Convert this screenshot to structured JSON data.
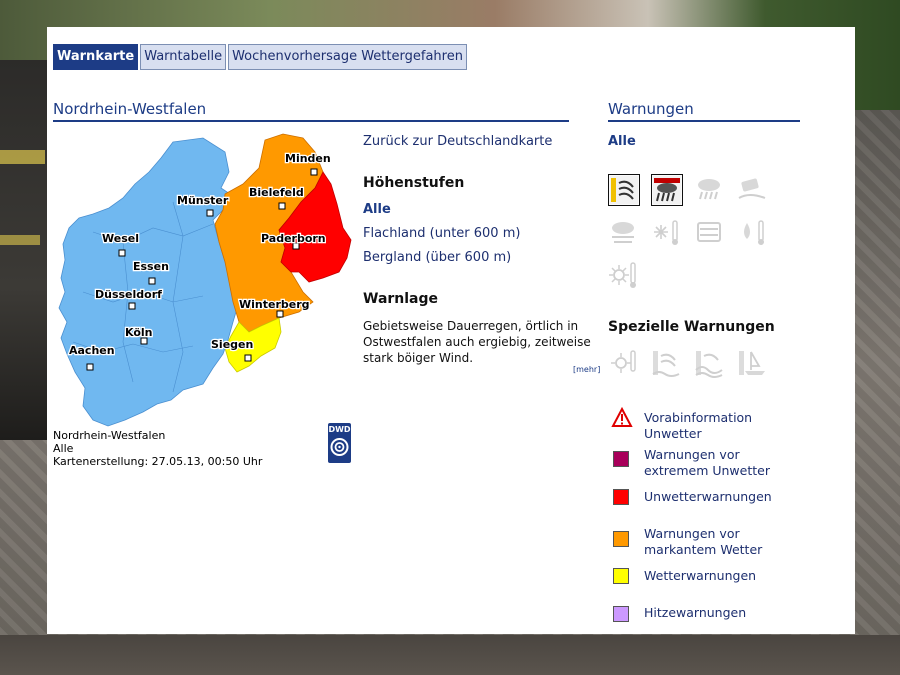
{
  "tabs": [
    {
      "label": "Warnkarte",
      "active": true
    },
    {
      "label": "Warntabelle",
      "active": false
    },
    {
      "label": "Wochenvorhersage Wettergefahren",
      "active": false
    }
  ],
  "region": {
    "title": "Nordrhein-Westfalen",
    "caption_line1": "Nordrhein-Westfalen",
    "caption_line2": "Alle",
    "caption_line3": "Kartenerstellung: 27.05.13, 00:50 Uhr",
    "logo_text": "DWD"
  },
  "cities": [
    "Minden",
    "Bielefeld",
    "Münster",
    "Paderborn",
    "Wesel",
    "Essen",
    "Düsseldorf",
    "Winterberg",
    "Köln",
    "Siegen",
    "Aachen"
  ],
  "middle": {
    "back_link": "Zurück zur Deutschlandkarte",
    "heights_title": "Höhenstufen",
    "heights_selected": "Alle",
    "flat_link": "Flachland (unter 600 m)",
    "mountain_link": "Bergland (über 600 m)",
    "situation_title": "Warnlage",
    "situation_text": "Gebietsweise Dauerregen, örtlich in Ostwestfalen auch ergiebig, zeitweise stark böiger Wind.",
    "more_link": "[mehr]"
  },
  "warnings": {
    "title": "Warnungen",
    "selected": "Alle",
    "icons": [
      "wind-icon",
      "heavy-rain-icon",
      "thunderstorm-icon",
      "black-ice-icon",
      "fog-icon",
      "frost-icon",
      "snow-icon",
      "thaw-icon",
      "heat-icon"
    ],
    "special_title": "Spezielle Warnungen",
    "special_icons": [
      "uv-icon",
      "coast-wind-icon",
      "storm-surge-icon",
      "sea-icon"
    ]
  },
  "legend": [
    {
      "label": "Vorabinformation Unwetter",
      "color": "#ffffff"
    },
    {
      "label": "Warnungen vor extremem Unwetter",
      "color": "#a8005a"
    },
    {
      "label": "Unwetterwarnungen",
      "color": "#ff0000"
    },
    {
      "label": "Warnungen vor markantem Wetter",
      "color": "#ff9900"
    },
    {
      "label": "Wetterwarnungen",
      "color": "#ffff00"
    },
    {
      "label": "Hitzewarnungen",
      "color": "#cc99ff"
    }
  ],
  "colors": {
    "accent": "#1d3c86",
    "no_warning": "#70b8f0",
    "severe": "#ff0000",
    "markant": "#ff9900",
    "weather": "#ffff00"
  }
}
